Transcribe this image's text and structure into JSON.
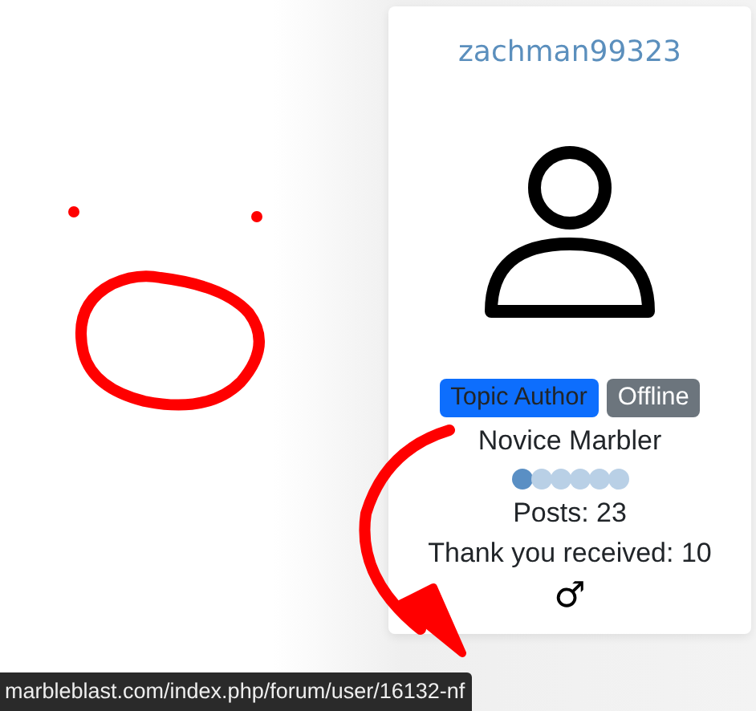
{
  "profile": {
    "username": "zachman99323",
    "badges": [
      {
        "label": "Topic Author",
        "kind": "author"
      },
      {
        "label": "Offline",
        "kind": "status"
      }
    ],
    "rank": "Novice Marbler",
    "stars": 1,
    "posts": "Posts: 23",
    "thanks": "Thank you received: 10",
    "gender": "♂"
  },
  "status_bar": {
    "url": "marbleblast.com/index.php/forum/user/16132-nf"
  }
}
